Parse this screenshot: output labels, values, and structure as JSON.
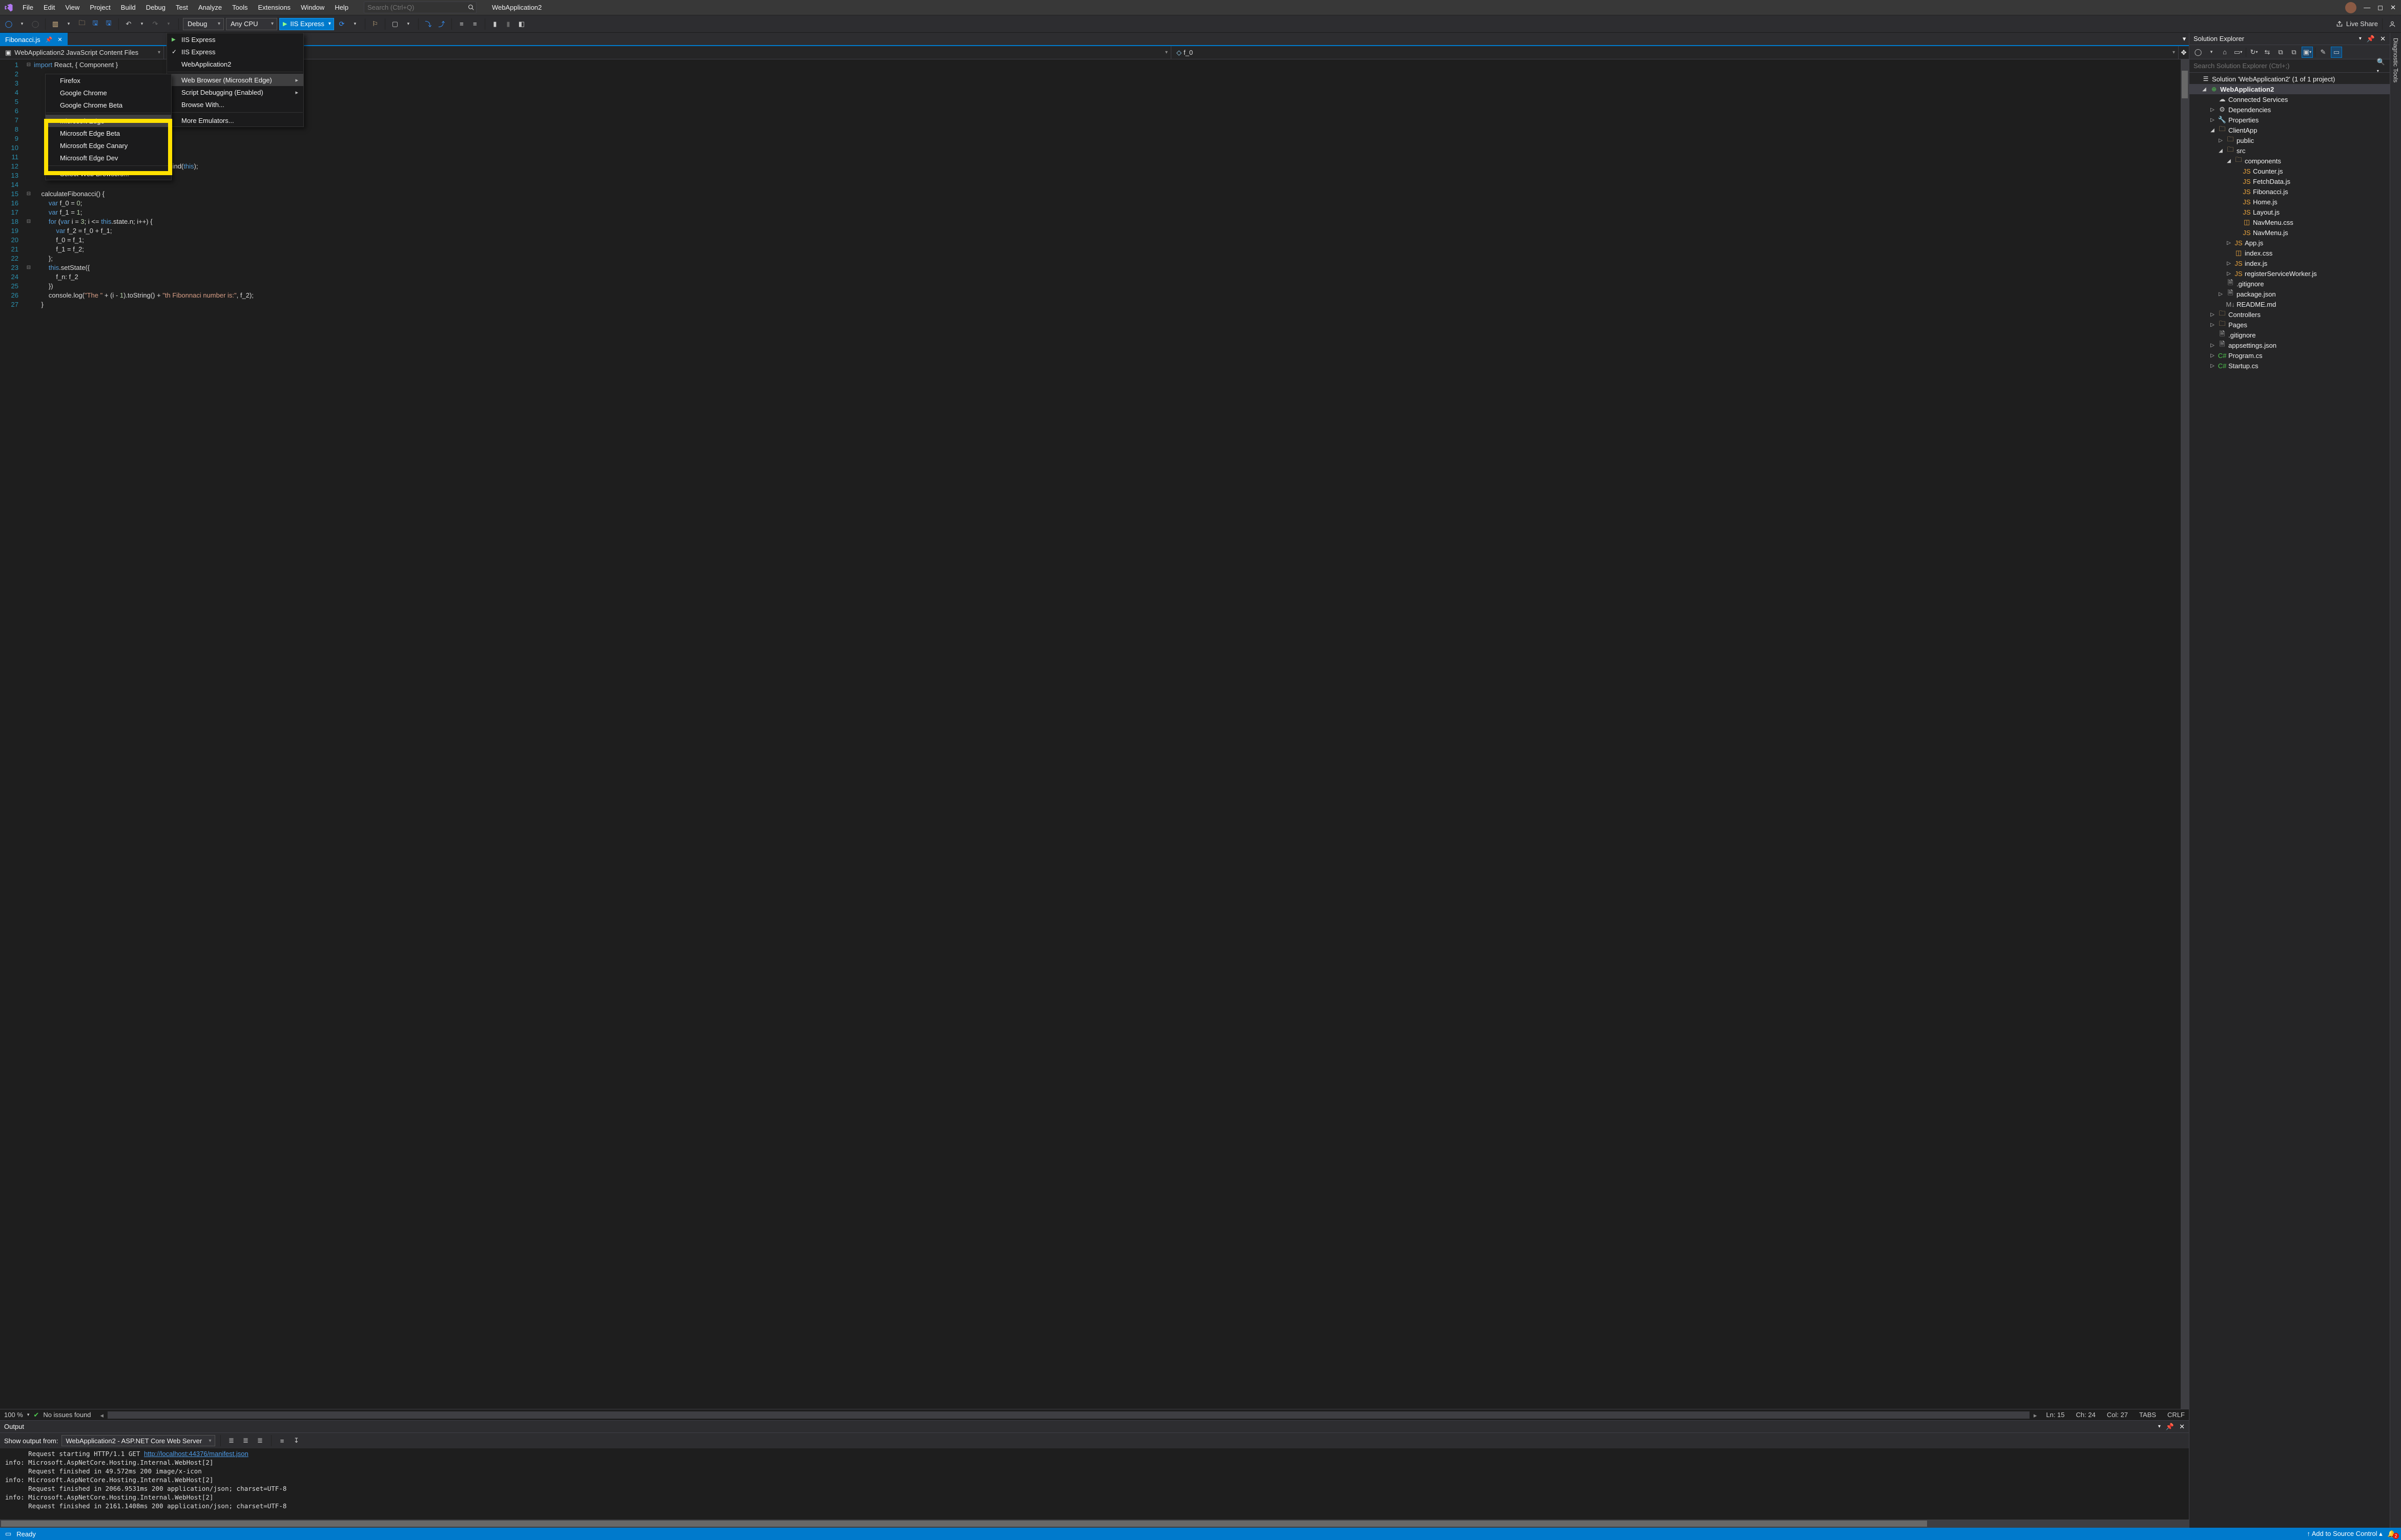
{
  "titlebar": {
    "menus": [
      "File",
      "Edit",
      "View",
      "Project",
      "Build",
      "Debug",
      "Test",
      "Analyze",
      "Tools",
      "Extensions",
      "Window",
      "Help"
    ],
    "search_placeholder": "Search (Ctrl+Q)",
    "app_title": "WebApplication2"
  },
  "toolbar": {
    "config": "Debug",
    "platform": "Any CPU",
    "run_label": "IIS Express",
    "live_share": "Live Share"
  },
  "run_menu": {
    "items": [
      {
        "label": "IIS Express",
        "run": true
      },
      {
        "label": "IIS Express",
        "check": true
      },
      {
        "label": "WebApplication2"
      },
      {
        "sep": true
      },
      {
        "label": "Web Browser (Microsoft Edge)",
        "hover": true,
        "arrow": true
      },
      {
        "label": "Script Debugging (Enabled)",
        "arrow": true
      },
      {
        "label": "Browse With..."
      },
      {
        "sep": true
      },
      {
        "label": "More Emulators..."
      }
    ]
  },
  "browser_menu": {
    "items": [
      {
        "label": "Firefox"
      },
      {
        "label": "Google Chrome"
      },
      {
        "label": "Google Chrome Beta"
      },
      {
        "sep": true
      },
      {
        "label": "Microsoft Edge",
        "check": true,
        "hover": true
      },
      {
        "label": "Microsoft Edge Beta"
      },
      {
        "label": "Microsoft Edge Canary"
      },
      {
        "label": "Microsoft Edge Dev"
      },
      {
        "sep": true
      },
      {
        "label": "Select Web Browsers..."
      }
    ]
  },
  "tabs": {
    "active": "Fibonacci.js"
  },
  "context": {
    "scope": "WebApplication2 JavaScript Content Files",
    "member": "f_0"
  },
  "editor": {
    "lines": [
      {
        "n": 1,
        "fold": "-",
        "html": "<span class='kw'>import</span> React, { Component }"
      },
      {
        "n": 2,
        "html": ""
      },
      {
        "n": 3,
        "html": ""
      },
      {
        "n": 4,
        "html": ""
      },
      {
        "n": 5,
        "html": ""
      },
      {
        "n": 6,
        "html": ""
      },
      {
        "n": 7,
        "html": ""
      },
      {
        "n": 8,
        "html": ""
      },
      {
        "n": 9,
        "html": ""
      },
      {
        "n": 10,
        "html": ""
      },
      {
        "n": 11,
        "html": ""
      },
      {
        "n": 12,
        "html": "                             ci = <span class='kw'>this</span>.calculateFibonacci.bind(<span class='kw'>this</span>);"
      },
      {
        "n": 13,
        "html": ""
      },
      {
        "n": 14,
        "html": ""
      },
      {
        "n": 15,
        "fold": "-",
        "html": "    calculateFibonacci() {"
      },
      {
        "n": 16,
        "html": "        <span class='kw'>var</span> f_0 = <span class='num'>0</span>;"
      },
      {
        "n": 17,
        "html": "        <span class='kw'>var</span> f_1 = <span class='num'>1</span>;"
      },
      {
        "n": 18,
        "fold": "-",
        "html": "        <span class='kw'>for</span> (<span class='kw'>var</span> i = <span class='num'>3</span>; i &lt;= <span class='kw'>this</span>.state.n; i++) {"
      },
      {
        "n": 19,
        "html": "            <span class='kw'>var</span> f_2 = f_0 + f_1;"
      },
      {
        "n": 20,
        "html": "            f_0 = f_1;"
      },
      {
        "n": 21,
        "html": "            f_1 = f_2;"
      },
      {
        "n": 22,
        "html": "        };"
      },
      {
        "n": 23,
        "fold": "-",
        "html": "        <span class='kw'>this</span>.setState({"
      },
      {
        "n": 24,
        "html": "            f_n: f_2"
      },
      {
        "n": 25,
        "html": "        })"
      },
      {
        "n": 26,
        "html": "        console.log(<span class='str'>\"The \"</span> + (i - <span class='num'>1</span>).toString() + <span class='str'>\"th Fibonnaci number is:\"</span>, f_2);"
      },
      {
        "n": 27,
        "html": "    }"
      }
    ]
  },
  "editor_status": {
    "zoom": "100 %",
    "issues": "No issues found",
    "ln": "Ln: 15",
    "ch": "Ch: 24",
    "col": "Col: 27",
    "tabs": "TABS",
    "eol": "CRLF"
  },
  "output": {
    "title": "Output",
    "from_label": "Show output from:",
    "from_value": "WebApplication2 - ASP.NET Core Web Server",
    "lines": [
      "      Request starting HTTP/1.1 GET <a>http://localhost:44376/manifest.json</a>",
      "info: Microsoft.AspNetCore.Hosting.Internal.WebHost[2]",
      "      Request finished in 49.572ms 200 image/x-icon",
      "info: Microsoft.AspNetCore.Hosting.Internal.WebHost[2]",
      "      Request finished in 2066.9531ms 200 application/json; charset=UTF-8",
      "info: Microsoft.AspNetCore.Hosting.Internal.WebHost[2]",
      "      Request finished in 2161.1408ms 200 application/json; charset=UTF-8"
    ]
  },
  "solution": {
    "title": "Solution Explorer",
    "search_placeholder": "Search Solution Explorer (Ctrl+;)",
    "root": "Solution 'WebApplication2' (1 of 1 project)",
    "project": "WebApplication2",
    "nodes": [
      {
        "pad": 2,
        "exp": "",
        "ic": "link",
        "label": "Connected Services"
      },
      {
        "pad": 2,
        "exp": "▷",
        "ic": "refs",
        "label": "Dependencies"
      },
      {
        "pad": 2,
        "exp": "▷",
        "ic": "wrench",
        "label": "Properties"
      },
      {
        "pad": 2,
        "exp": "◢",
        "ic": "folder",
        "label": "ClientApp"
      },
      {
        "pad": 3,
        "exp": "▷",
        "ic": "folder",
        "label": "public"
      },
      {
        "pad": 3,
        "exp": "◢",
        "ic": "folder",
        "label": "src"
      },
      {
        "pad": 4,
        "exp": "◢",
        "ic": "folder",
        "label": "components"
      },
      {
        "pad": 5,
        "exp": "",
        "ic": "js",
        "label": "Counter.js"
      },
      {
        "pad": 5,
        "exp": "",
        "ic": "js",
        "label": "FetchData.js"
      },
      {
        "pad": 5,
        "exp": "",
        "ic": "js",
        "label": "Fibonacci.js"
      },
      {
        "pad": 5,
        "exp": "",
        "ic": "js",
        "label": "Home.js"
      },
      {
        "pad": 5,
        "exp": "",
        "ic": "js",
        "label": "Layout.js"
      },
      {
        "pad": 5,
        "exp": "",
        "ic": "css",
        "label": "NavMenu.css"
      },
      {
        "pad": 5,
        "exp": "",
        "ic": "js",
        "label": "NavMenu.js"
      },
      {
        "pad": 4,
        "exp": "▷",
        "ic": "js",
        "label": "App.js"
      },
      {
        "pad": 4,
        "exp": "",
        "ic": "css",
        "label": "index.css"
      },
      {
        "pad": 4,
        "exp": "▷",
        "ic": "js",
        "label": "index.js"
      },
      {
        "pad": 4,
        "exp": "▷",
        "ic": "js",
        "label": "registerServiceWorker.js"
      },
      {
        "pad": 3,
        "exp": "",
        "ic": "file",
        "label": ".gitignore"
      },
      {
        "pad": 3,
        "exp": "▷",
        "ic": "json",
        "label": "package.json"
      },
      {
        "pad": 3,
        "exp": "",
        "ic": "md",
        "label": "README.md"
      },
      {
        "pad": 2,
        "exp": "▷",
        "ic": "folder",
        "label": "Controllers"
      },
      {
        "pad": 2,
        "exp": "▷",
        "ic": "folder",
        "label": "Pages"
      },
      {
        "pad": 2,
        "exp": "",
        "ic": "file",
        "label": ".gitignore"
      },
      {
        "pad": 2,
        "exp": "▷",
        "ic": "json",
        "label": "appsettings.json"
      },
      {
        "pad": 2,
        "exp": "▷",
        "ic": "cs",
        "label": "Program.cs"
      },
      {
        "pad": 2,
        "exp": "▷",
        "ic": "cs",
        "label": "Startup.cs"
      }
    ]
  },
  "side_tab": "Diagnostic Tools",
  "statusbar": {
    "ready": "Ready",
    "src_ctrl": "Add to Source Control",
    "badge": "2"
  }
}
